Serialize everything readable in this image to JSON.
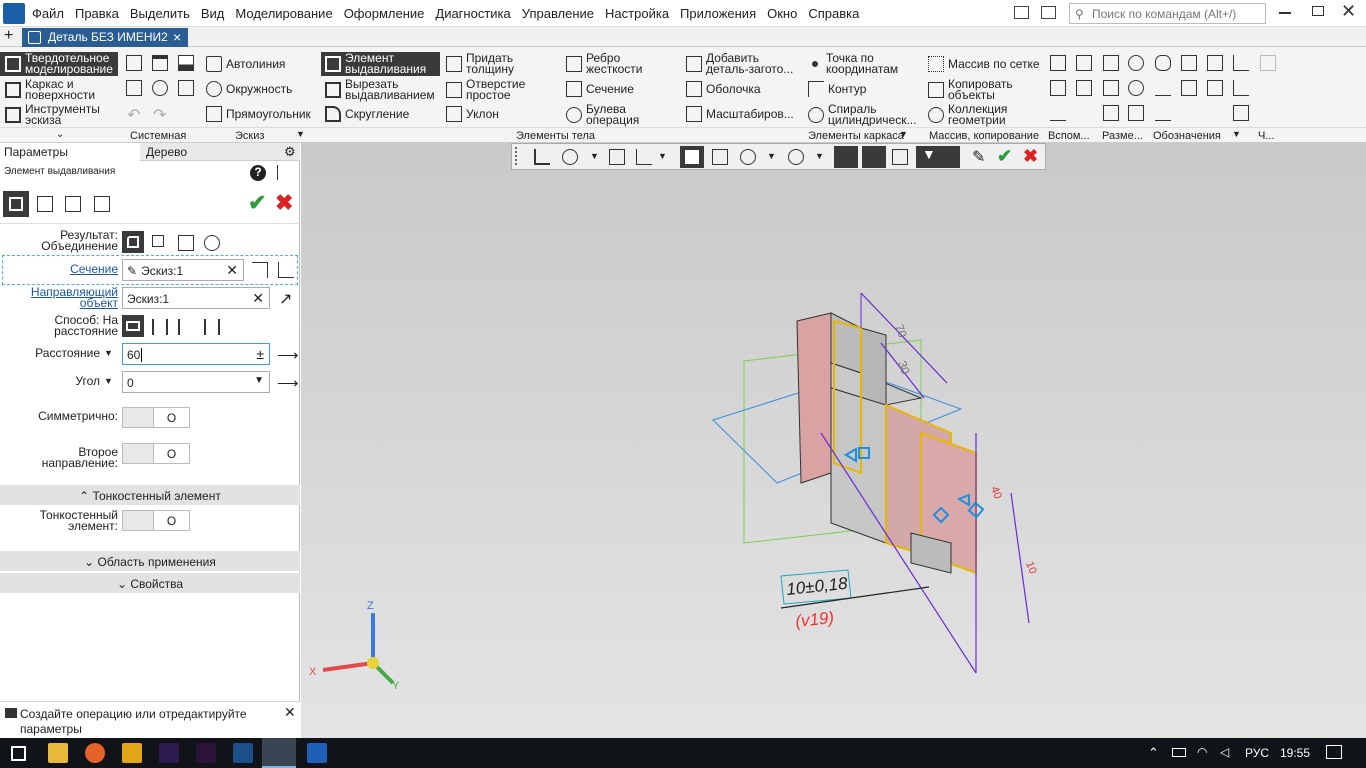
{
  "menu": {
    "items": [
      "Файл",
      "Правка",
      "Выделить",
      "Вид",
      "Моделирование",
      "Оформление",
      "Диагностика",
      "Управление",
      "Настройка",
      "Приложения",
      "Окно",
      "Справка"
    ],
    "search_placeholder": "Поиск по командам (Alt+/)"
  },
  "tabs": {
    "document": "Деталь БЕЗ ИМЕНИ2",
    "add": "+",
    "close": "×"
  },
  "ribbon": {
    "modes": [
      "Твердотельное моделирование",
      "Каркас и поверхности",
      "Инструменты эскиза"
    ],
    "sketch": [
      "Автолиния",
      "Окружность",
      "Прямоугольник"
    ],
    "body_col1": [
      "Элемент выдавливания",
      "Вырезать выдавливанием",
      "Скругление"
    ],
    "body_col2": [
      "Придать толщину",
      "Отверстие простое",
      "Уклон"
    ],
    "body_col3": [
      "Ребро жесткости",
      "Сечение",
      "Булева операция"
    ],
    "body_col4": [
      "Добавить деталь-загото...",
      "Оболочка",
      "Масштабиров..."
    ],
    "frame": [
      "Точка по координатам",
      "Контур",
      "Спираль цилиндрическ..."
    ],
    "array": [
      "Массив по сетке",
      "Копировать объекты",
      "Коллекция геометрии"
    ],
    "groups": [
      "Системная",
      "Эскиз",
      "Элементы тела",
      "Элементы каркаса",
      "Массив, копирование",
      "Вспом...",
      "Разме...",
      "Обозначения",
      "Ч..."
    ]
  },
  "panel": {
    "tabs": [
      "Параметры",
      "Дерево"
    ],
    "title": "Элемент выдавливания",
    "result_label": "Результат: Объединение",
    "section_label": "Сечение",
    "section_value": "Эскиз:1",
    "guide_label": "Направляющий объект",
    "guide_value": "Эскиз:1",
    "method_label": "Способ: На расстояние",
    "distance_label": "Расстояние",
    "distance_value": "60",
    "angle_label": "Угол",
    "angle_value": "0",
    "symmetric_label": "Симметрично:",
    "second_dir_label": "Второе направление:",
    "toggle_text": "О",
    "thin_section": "Тонкостенный элемент",
    "thin_label": "Тонкостенный элемент:",
    "scope_section": "Область применения",
    "props_section": "Свойства",
    "hint": "Создайте операцию или отредактируйте параметры"
  },
  "viewport": {
    "dim_main": "10±0,18",
    "dim_sub": "(v19)",
    "dims": [
      "70",
      "30",
      "40",
      "10"
    ],
    "axes": {
      "x": "X",
      "y": "Y",
      "z": "Z"
    }
  },
  "taskbar": {
    "lang": "РУС",
    "time": "19:55"
  },
  "colors": {
    "accent": "#1b5fa8",
    "ok": "#2e9b3a",
    "cancel": "#d22",
    "select": "#3a3a3a",
    "dim": "#6a2bd6"
  }
}
